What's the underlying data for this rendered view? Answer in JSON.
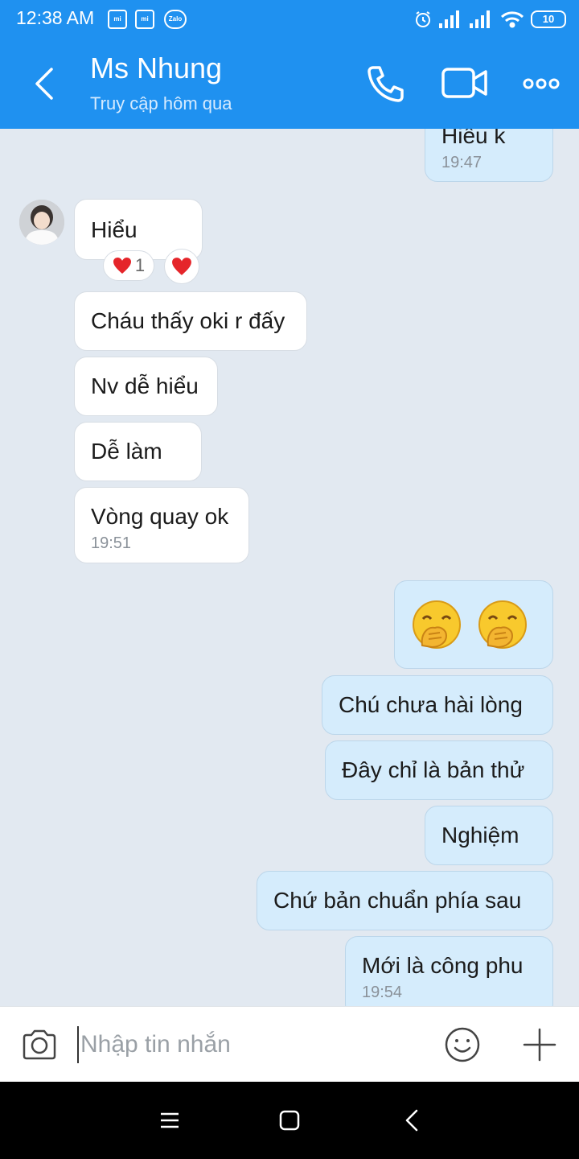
{
  "status_bar": {
    "time": "12:38 AM",
    "apps": [
      "mi",
      "mi",
      "Zalo"
    ],
    "battery": "10"
  },
  "header": {
    "contact_name": "Ms Nhung",
    "last_seen": "Truy cập hôm qua",
    "icons": [
      "back-arrow-icon",
      "phone-icon",
      "video-camera-icon",
      "more-icon"
    ]
  },
  "messages": {
    "m0": {
      "text": "Hiểu k",
      "time": "19:47"
    },
    "m1": {
      "text": "Hiểu",
      "reaction_count": "1"
    },
    "m2": {
      "text": "Cháu thấy oki r đấy"
    },
    "m3": {
      "text": "Nv dễ hiểu"
    },
    "m4": {
      "text": "Dễ làm"
    },
    "m5": {
      "text": "Vòng quay ok",
      "time": "19:51"
    },
    "m7": {
      "text": "Chú chưa hài lòng"
    },
    "m8": {
      "text": "Đây chỉ là bản thử"
    },
    "m9": {
      "text": "Nghiệm"
    },
    "m10": {
      "text": "Chứ bản chuẩn phía sau"
    },
    "m11": {
      "text": "Mới là công phu",
      "time": "19:54"
    }
  },
  "input": {
    "placeholder": "Nhập tin nhắn"
  },
  "colors": {
    "header_blue": "#1f91f0",
    "chat_background": "#e2e9f1",
    "incoming_bubble": "#ffffff",
    "outgoing_bubble": "#d5ecfc"
  }
}
